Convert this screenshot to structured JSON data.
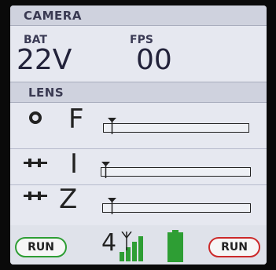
{
  "header": {
    "title": "CAMERA"
  },
  "status": {
    "battery_label": "BAT",
    "battery_value": "22V",
    "fps_label": "FPS",
    "fps_value": "00"
  },
  "lens": {
    "title": "LENS",
    "rows": [
      {
        "letter": "F",
        "icon": "iris-icon",
        "level": 0.06
      },
      {
        "letter": "I",
        "icon": "slider-ticks-icon",
        "level": 0.0
      },
      {
        "letter": "Z",
        "icon": "slider-ticks-icon",
        "level": 0.06
      }
    ]
  },
  "footer": {
    "left_button": "RUN",
    "channel": "4",
    "right_button": "RUN",
    "colors": {
      "green": "#2e9e34",
      "red": "#cc2a2a",
      "battery": "#2e9e34"
    }
  }
}
